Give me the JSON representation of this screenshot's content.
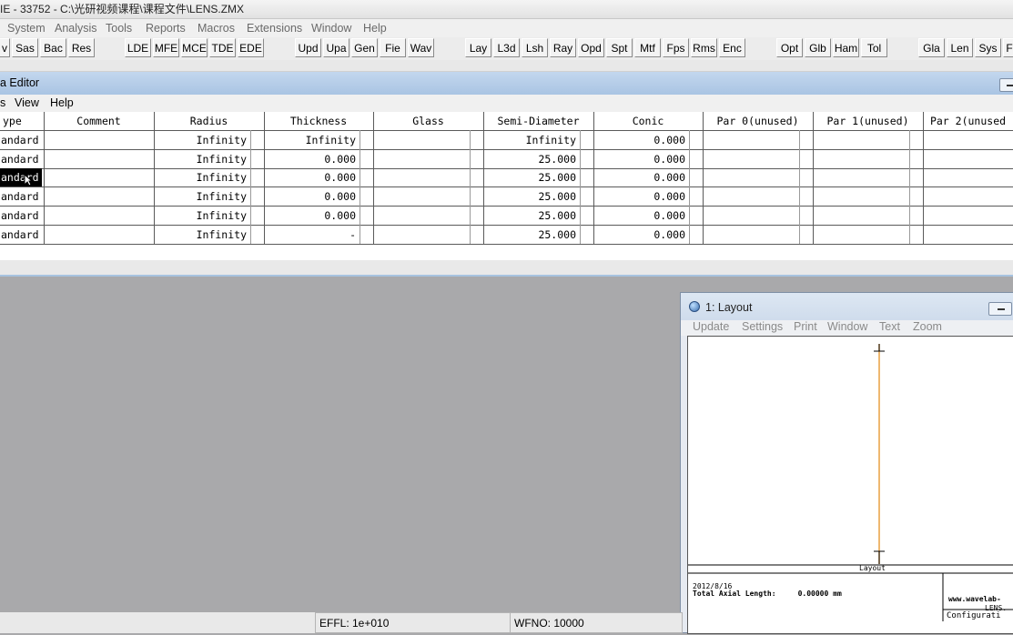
{
  "title_bar": {
    "text": "IE - 33752 - C:\\光研视频课程\\课程文件\\LENS.ZMX"
  },
  "main_menu": [
    "System",
    "Analysis",
    "Tools",
    "Reports",
    "Macros",
    "Extensions",
    "Window",
    "Help"
  ],
  "toolbar": {
    "buttons": [
      "v",
      "Sas",
      "Bac",
      "Res",
      "LDE",
      "MFE",
      "MCE",
      "TDE",
      "EDE",
      "Upd",
      "Upa",
      "Gen",
      "Fie",
      "Wav",
      "Lay",
      "L3d",
      "Lsh",
      "Ray",
      "Opd",
      "Spt",
      "Mtf",
      "Fps",
      "Rms",
      "Enc",
      "Opt",
      "Glb",
      "Ham",
      "Tol",
      "Gla",
      "Len",
      "Sys",
      "F"
    ]
  },
  "lens_editor": {
    "title": "a Editor",
    "menu": [
      "s",
      "View",
      "Help"
    ],
    "columns": [
      "ype",
      "Comment",
      "Radius",
      "Thickness",
      "Glass",
      "Semi-Diameter",
      "Conic",
      "Par 0(unused)",
      "Par 1(unused)",
      "Par 2(unused"
    ],
    "rows": [
      {
        "type": "andard",
        "comment": "",
        "radius": "Infinity",
        "thickness": "Infinity",
        "glass": "",
        "semi_diameter": "Infinity",
        "conic": "0.000"
      },
      {
        "type": "andard",
        "comment": "",
        "radius": "Infinity",
        "thickness": "0.000",
        "glass": "",
        "semi_diameter": "25.000",
        "conic": "0.000"
      },
      {
        "type": "andard",
        "comment": "",
        "radius": "Infinity",
        "thickness": "0.000",
        "glass": "",
        "semi_diameter": "25.000",
        "conic": "0.000",
        "selected": true
      },
      {
        "type": "andard",
        "comment": "",
        "radius": "Infinity",
        "thickness": "0.000",
        "glass": "",
        "semi_diameter": "25.000",
        "conic": "0.000"
      },
      {
        "type": "andard",
        "comment": "",
        "radius": "Infinity",
        "thickness": "0.000",
        "glass": "",
        "semi_diameter": "25.000",
        "conic": "0.000"
      },
      {
        "type": "andard",
        "comment": "",
        "radius": "Infinity",
        "thickness": "-",
        "glass": "",
        "semi_diameter": "25.000",
        "conic": "0.000"
      }
    ]
  },
  "layout_window": {
    "title": "1: Layout",
    "menu": [
      "Update",
      "Settings",
      "Print",
      "Window",
      "Text",
      "Zoom"
    ],
    "plot_label": "Layout",
    "date": "2012/8/16",
    "total_axial_length": "Total Axial Length:     0.00000 mm",
    "website": "www.wavelab-",
    "file": "LENS.",
    "config": "Configurati"
  },
  "status_bar": {
    "effl": "EFFL: 1e+010",
    "wfno": "WFNO: 10000"
  },
  "colors": {
    "selected_bg": "#000000",
    "title_blue": "#b6cde8",
    "lens_line": "#e8a040"
  },
  "icons": [
    "layout-window-icon",
    "minimize-icon",
    "cursor-icon"
  ]
}
